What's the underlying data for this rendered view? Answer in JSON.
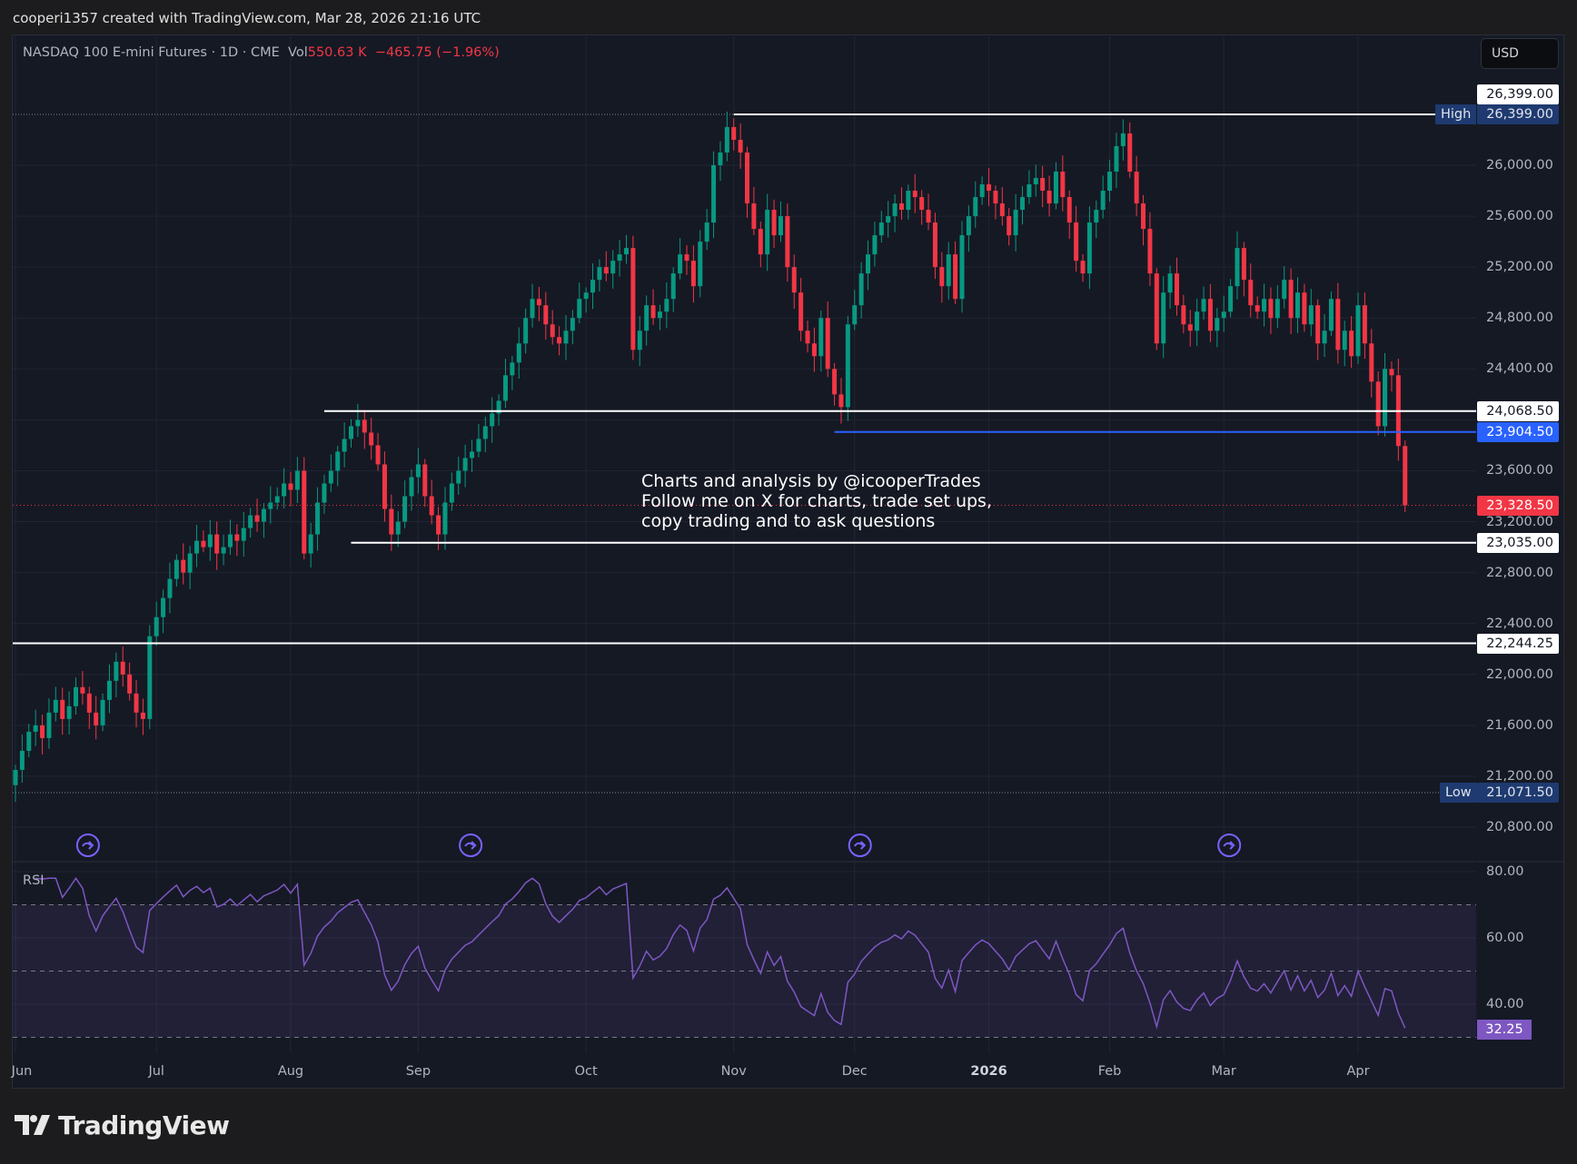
{
  "header": {
    "credit": "cooperi1357 created with TradingView.com, Mar 28, 2026 21:16 UTC"
  },
  "legend": {
    "symbol": "NASDAQ 100 E-mini Futures · 1D · CME",
    "vol_label": "Vol",
    "vol_value": "550.63 K",
    "change": "−465.75 (−1.96%)"
  },
  "currency_button": "USD",
  "annotation": "Charts and analysis by @icooperTrades\nFollow me on X for charts, trade set ups,\ncopy trading and to ask questions",
  "colors": {
    "up": "#089981",
    "down": "#f23645",
    "level": "#ffffff",
    "support_blue": "#2962ff",
    "rsi": "#7e57c2"
  },
  "chart_data": {
    "type": "candlestick",
    "title": "NASDAQ 100 E-mini Futures · 1D · CME",
    "prior_close": 23794.25,
    "closes": [
      21250,
      21400,
      21550,
      21600,
      21500,
      21700,
      21800,
      21650,
      21750,
      21900,
      21850,
      21700,
      21600,
      21800,
      21950,
      22100,
      22000,
      21850,
      21700,
      21650,
      22300,
      22450,
      22600,
      22750,
      22900,
      22800,
      22950,
      23050,
      23000,
      23100,
      22950,
      23000,
      23100,
      23050,
      23150,
      23250,
      23200,
      23300,
      23350,
      23400,
      23500,
      23450,
      23600,
      22950,
      23100,
      23350,
      23500,
      23600,
      23750,
      23850,
      23950,
      24000,
      23900,
      23800,
      23650,
      23300,
      23100,
      23200,
      23400,
      23550,
      23650,
      23400,
      23250,
      23100,
      23350,
      23500,
      23600,
      23700,
      23750,
      23850,
      23950,
      24050,
      24150,
      24350,
      24450,
      24600,
      24800,
      24950,
      24900,
      24750,
      24650,
      24600,
      24700,
      24800,
      24950,
      25000,
      25100,
      25200,
      25150,
      25250,
      25300,
      25350,
      24550,
      24700,
      24900,
      24800,
      24850,
      24950,
      25150,
      25300,
      25250,
      25050,
      25400,
      25550,
      26000,
      26100,
      26300,
      26200,
      26100,
      25700,
      25500,
      25300,
      25650,
      25450,
      25600,
      25200,
      25000,
      24700,
      24600,
      24500,
      24800,
      24400,
      24200,
      24100,
      24750,
      24900,
      25150,
      25300,
      25450,
      25550,
      25600,
      25700,
      25650,
      25800,
      25750,
      25650,
      25550,
      25200,
      25050,
      25300,
      24950,
      25450,
      25600,
      25750,
      25850,
      25800,
      25700,
      25600,
      25450,
      25650,
      25750,
      25850,
      25900,
      25800,
      25700,
      25950,
      25750,
      25550,
      25250,
      25150,
      25550,
      25650,
      25800,
      25950,
      26150,
      26250,
      25950,
      25700,
      25500,
      25150,
      24600,
      25000,
      25150,
      24900,
      24750,
      24700,
      24850,
      24950,
      24700,
      24800,
      24850,
      25050,
      25350,
      25100,
      24900,
      24850,
      24950,
      24800,
      24950,
      25100,
      24800,
      25000,
      24750,
      24900,
      24600,
      24700,
      24950,
      24550,
      24700,
      24500,
      24900,
      24600,
      24300,
      23950,
      24400,
      24350,
      23794.25,
      23328.5
    ],
    "price_ticks": [
      20800,
      21200,
      21600,
      22000,
      22400,
      22800,
      23200,
      23600,
      24000,
      24400,
      24800,
      25200,
      25600,
      26000
    ],
    "price_tick_labels": [
      "20,800.00",
      "21,200.00",
      "21,600.00",
      "22,000.00",
      "22,400.00",
      "22,800.00",
      "23,200.00",
      "23,600.00",
      "24,400.00",
      "24,800.00",
      "25,200.00",
      "25,600.00",
      "26,000.00"
    ],
    "time_labels": [
      {
        "label": "Jun",
        "index": 0
      },
      {
        "label": "Jul",
        "index": 21
      },
      {
        "label": "Aug",
        "index": 41
      },
      {
        "label": "Sep",
        "index": 60
      },
      {
        "label": "Oct",
        "index": 85
      },
      {
        "label": "Nov",
        "index": 107
      },
      {
        "label": "Dec",
        "index": 125
      },
      {
        "label": "2026",
        "index": 145,
        "bold": true
      },
      {
        "label": "Feb",
        "index": 163
      },
      {
        "label": "Mar",
        "index": 180
      },
      {
        "label": "Apr",
        "index": 200
      }
    ],
    "levels": [
      {
        "name": "level-26399",
        "price": 26399.0,
        "label": "26,399.00",
        "start_index": 107,
        "style": "white"
      },
      {
        "name": "level-24068",
        "price": 24068.5,
        "label": "24,068.50",
        "start_index": 46,
        "style": "white"
      },
      {
        "name": "level-23904",
        "price": 23904.5,
        "label": "23,904.50",
        "start_index": 122,
        "style": "blue"
      },
      {
        "name": "level-23035",
        "price": 23035.0,
        "label": "23,035.00",
        "start_index": 50,
        "style": "white"
      },
      {
        "name": "level-22244",
        "price": 22244.25,
        "label": "22,244.25",
        "start_index": -2,
        "style": "white"
      }
    ],
    "high": {
      "label": "High",
      "value": 26399.0,
      "text": "26,399.00"
    },
    "low": {
      "label": "Low",
      "value": 21071.5,
      "text": "21,071.50"
    },
    "last_price": {
      "value": 23328.5,
      "text": "23,328.50"
    },
    "event_indices": [
      10,
      67,
      125,
      180
    ],
    "rsi": {
      "title": "RSI",
      "period": 14,
      "last": "32.25",
      "last_value": 32.25,
      "upper": 70,
      "middle": 50,
      "lower": 30,
      "ticks": [
        {
          "v": 80,
          "t": "80.00"
        },
        {
          "v": 60,
          "t": "60.00"
        },
        {
          "v": 40,
          "t": "40.00"
        }
      ]
    }
  },
  "footer": {
    "brand": "TradingView"
  }
}
